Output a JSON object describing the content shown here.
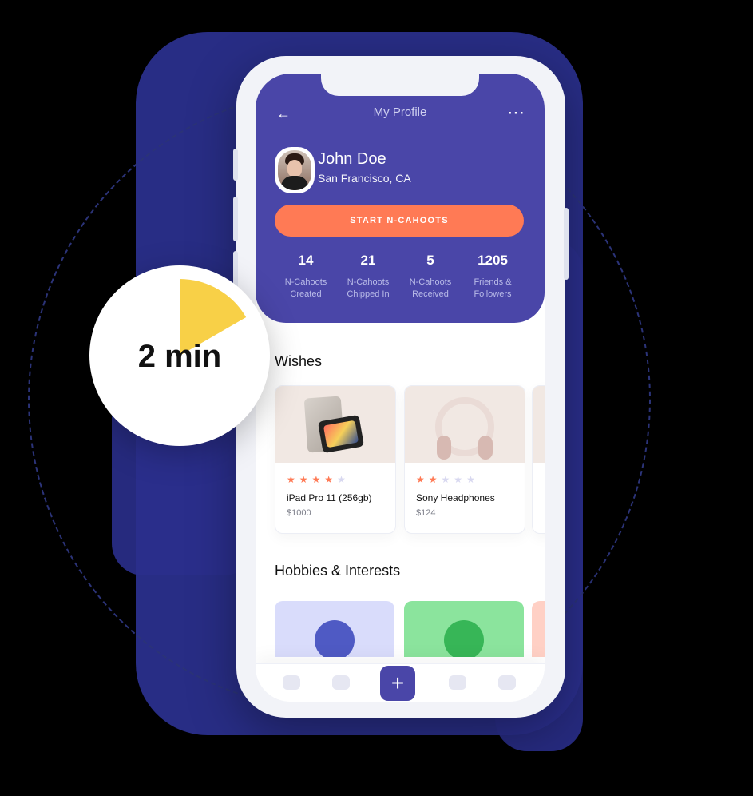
{
  "timer": {
    "label": "2 min"
  },
  "header": {
    "title": "My Profile",
    "back_icon": "back-arrow-icon",
    "more_icon": "more-dots-icon"
  },
  "profile": {
    "name": "John Doe",
    "location": "San Francisco, CA",
    "cta": "START N-CAHOOTS"
  },
  "stats": [
    {
      "value": "14",
      "label": "N-Cahoots\nCreated"
    },
    {
      "value": "21",
      "label": "N-Cahoots\nChipped In"
    },
    {
      "value": "5",
      "label": "N-Cahoots\nReceived"
    },
    {
      "value": "1205",
      "label": "Friends &\nFollowers"
    }
  ],
  "sections": {
    "wishes": "Wishes",
    "hobbies": "Hobbies & Interests"
  },
  "wishes": [
    {
      "name": "iPad Pro 11 (256gb)",
      "price": "$1000",
      "rating": 4,
      "max": 5
    },
    {
      "name": "Sony Headphones",
      "price": "$124",
      "rating": 2,
      "max": 5
    }
  ],
  "colors": {
    "primary": "#4a46a8",
    "accent": "#ff7a55",
    "timer": "#f8d047",
    "star_on": "#ff7a55",
    "star_off": "#d8d8f0"
  }
}
